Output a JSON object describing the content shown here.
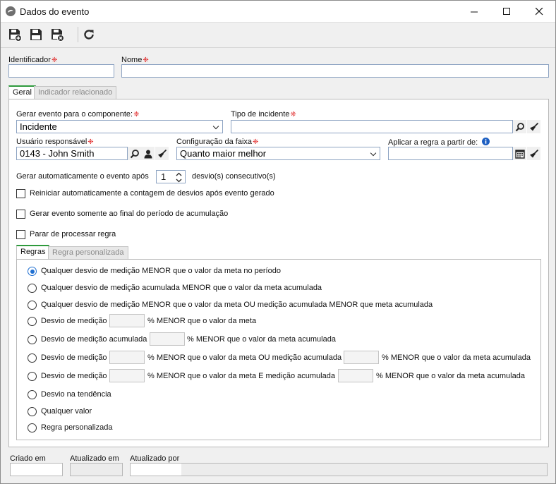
{
  "window": {
    "title": "Dados do evento",
    "minimize": "—",
    "maximize": "☐",
    "close": "✕"
  },
  "toolbar": {
    "save_new_icon": "save-new-icon",
    "save_icon": "save-icon",
    "save_close_icon": "save-close-icon",
    "refresh_icon": "refresh-icon"
  },
  "header": {
    "identifier_label": "Identificador",
    "identifier_value": "",
    "name_label": "Nome",
    "name_value": ""
  },
  "tabs": [
    {
      "label": "Geral",
      "active": true
    },
    {
      "label": "Indicador relacionado",
      "active": false
    }
  ],
  "geral": {
    "component_label": "Gerar evento para o componente:",
    "component_value": "Incidente",
    "incident_type_label": "Tipo de incidente",
    "incident_type_value": "",
    "user_label": "Usuário responsável",
    "user_value": "0143 - John Smith",
    "range_label": "Configuração da faixa",
    "range_value": "Quanto maior melhor",
    "apply_from_label": "Aplicar a regra a partir de:",
    "apply_from_value": "",
    "auto_prefix": "Gerar automaticamente o evento após",
    "auto_count": "1",
    "auto_suffix": "desvio(s) consecutivo(s)",
    "checkboxes": [
      {
        "label": "Reiniciar automaticamente a contagem de desvios após evento gerado",
        "checked": false
      },
      {
        "label": "Gerar evento somente ao final do período de acumulação",
        "checked": false
      },
      {
        "label": "Parar de processar regra",
        "checked": false
      }
    ]
  },
  "rule_tabs": [
    {
      "label": "Regras",
      "active": true
    },
    {
      "label": "Regra personalizada",
      "active": false
    }
  ],
  "rules": {
    "r1": "Qualquer desvio de medição MENOR que o valor da meta no período",
    "r2": "Qualquer desvio de medição acumulada MENOR que o valor da meta acumulada",
    "r3": "Qualquer desvio de medição MENOR que o valor da meta OU medição acumulada MENOR que meta acumulada",
    "r4a": "Desvio de medição",
    "r4b": "% MENOR que o valor da meta",
    "r5a": "Desvio de medição acumulada",
    "r5b": "% MENOR que o valor da meta acumulada",
    "r6a": "Desvio de medição",
    "r6b": "% MENOR que o valor da meta OU medição acumulada",
    "r6c": "% MENOR que o valor da meta acumulada",
    "r7a": "Desvio de medição",
    "r7b": "% MENOR que o valor da meta E medição acumulada",
    "r7c": "% MENOR que o valor da meta acumulada",
    "r8": "Desvio na tendência",
    "r9": "Qualquer valor",
    "r10": "Regra personalizada",
    "selected": 1
  },
  "footer": {
    "created_label": "Criado em",
    "created_value": "",
    "updated_label": "Atualizado em",
    "updated_value": "",
    "updated_by_label": "Atualizado por",
    "updated_by_value": ""
  }
}
